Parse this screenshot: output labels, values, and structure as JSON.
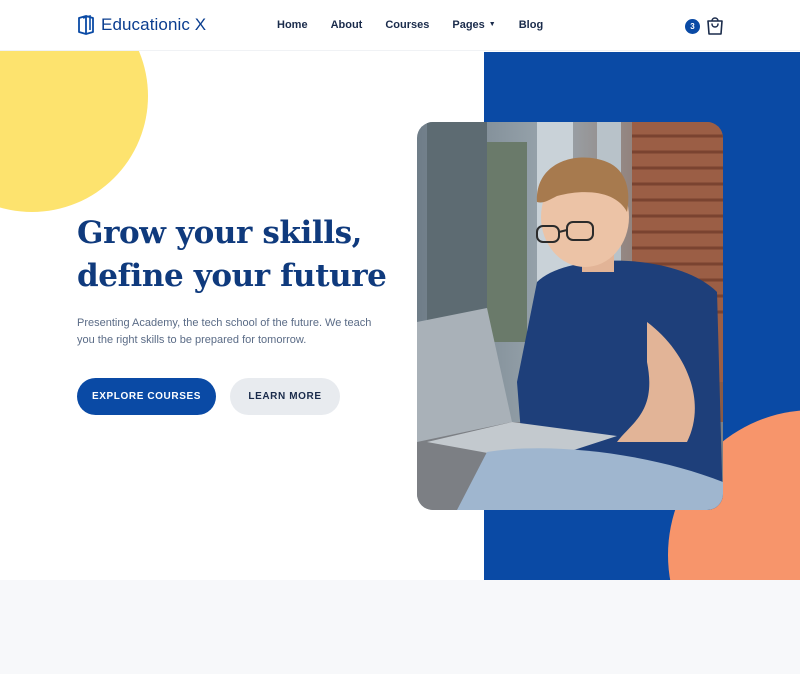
{
  "brand": {
    "name": "Educationic X",
    "icon": "book-icon"
  },
  "nav": {
    "items": [
      {
        "label": "Home"
      },
      {
        "label": "About"
      },
      {
        "label": "Courses"
      },
      {
        "label": "Pages",
        "has_dropdown": true
      },
      {
        "label": "Blog"
      }
    ]
  },
  "cart": {
    "count": "3",
    "icon": "shopping-bag-icon"
  },
  "hero": {
    "title_line1": "Grow your skills,",
    "title_line2": "define your future",
    "description": "Presenting Academy, the tech school of the future. We teach you the right skills to be prepared for tomorrow.",
    "primary_button": "EXPLORE COURSES",
    "secondary_button": "LEARN MORE",
    "image_alt": "Student with laptop"
  },
  "colors": {
    "primary": "#0a4aa5",
    "heading": "#0f3a7d",
    "yellow_accent": "#fde36e",
    "orange_accent": "#f7956b"
  }
}
